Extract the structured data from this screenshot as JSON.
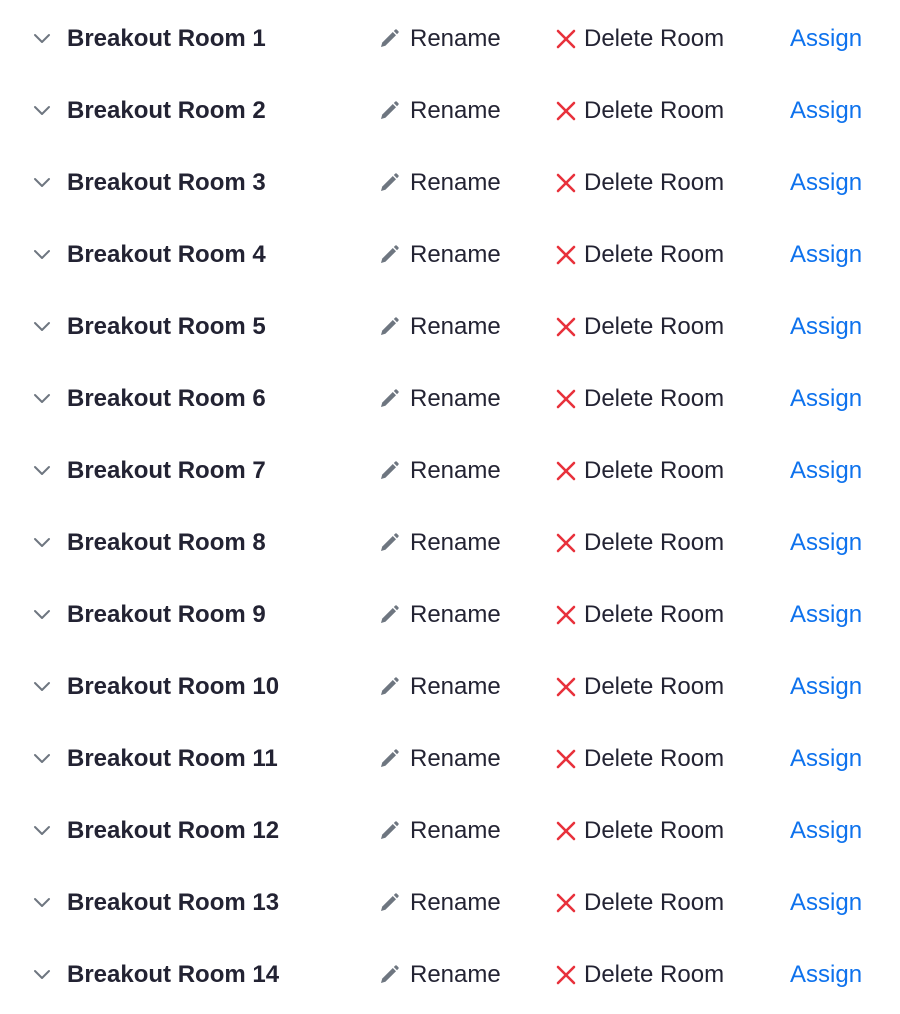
{
  "actions": {
    "rename_label": "Rename",
    "delete_label": "Delete Room",
    "assign_label": "Assign"
  },
  "colors": {
    "text": "#232333",
    "icon_gray": "#6e7680",
    "delete_red": "#e8313b",
    "assign_blue": "#0e72ed"
  },
  "icons": {
    "expand": "chevron-down-icon",
    "rename": "pencil-icon",
    "delete": "close-icon"
  },
  "rooms": [
    {
      "name": "Breakout Room 1"
    },
    {
      "name": "Breakout Room 2"
    },
    {
      "name": "Breakout Room 3"
    },
    {
      "name": "Breakout Room 4"
    },
    {
      "name": "Breakout Room 5"
    },
    {
      "name": "Breakout Room 6"
    },
    {
      "name": "Breakout Room 7"
    },
    {
      "name": "Breakout Room 8"
    },
    {
      "name": "Breakout Room 9"
    },
    {
      "name": "Breakout Room 10"
    },
    {
      "name": "Breakout Room 11"
    },
    {
      "name": "Breakout Room 12"
    },
    {
      "name": "Breakout Room 13"
    },
    {
      "name": "Breakout Room 14"
    }
  ]
}
